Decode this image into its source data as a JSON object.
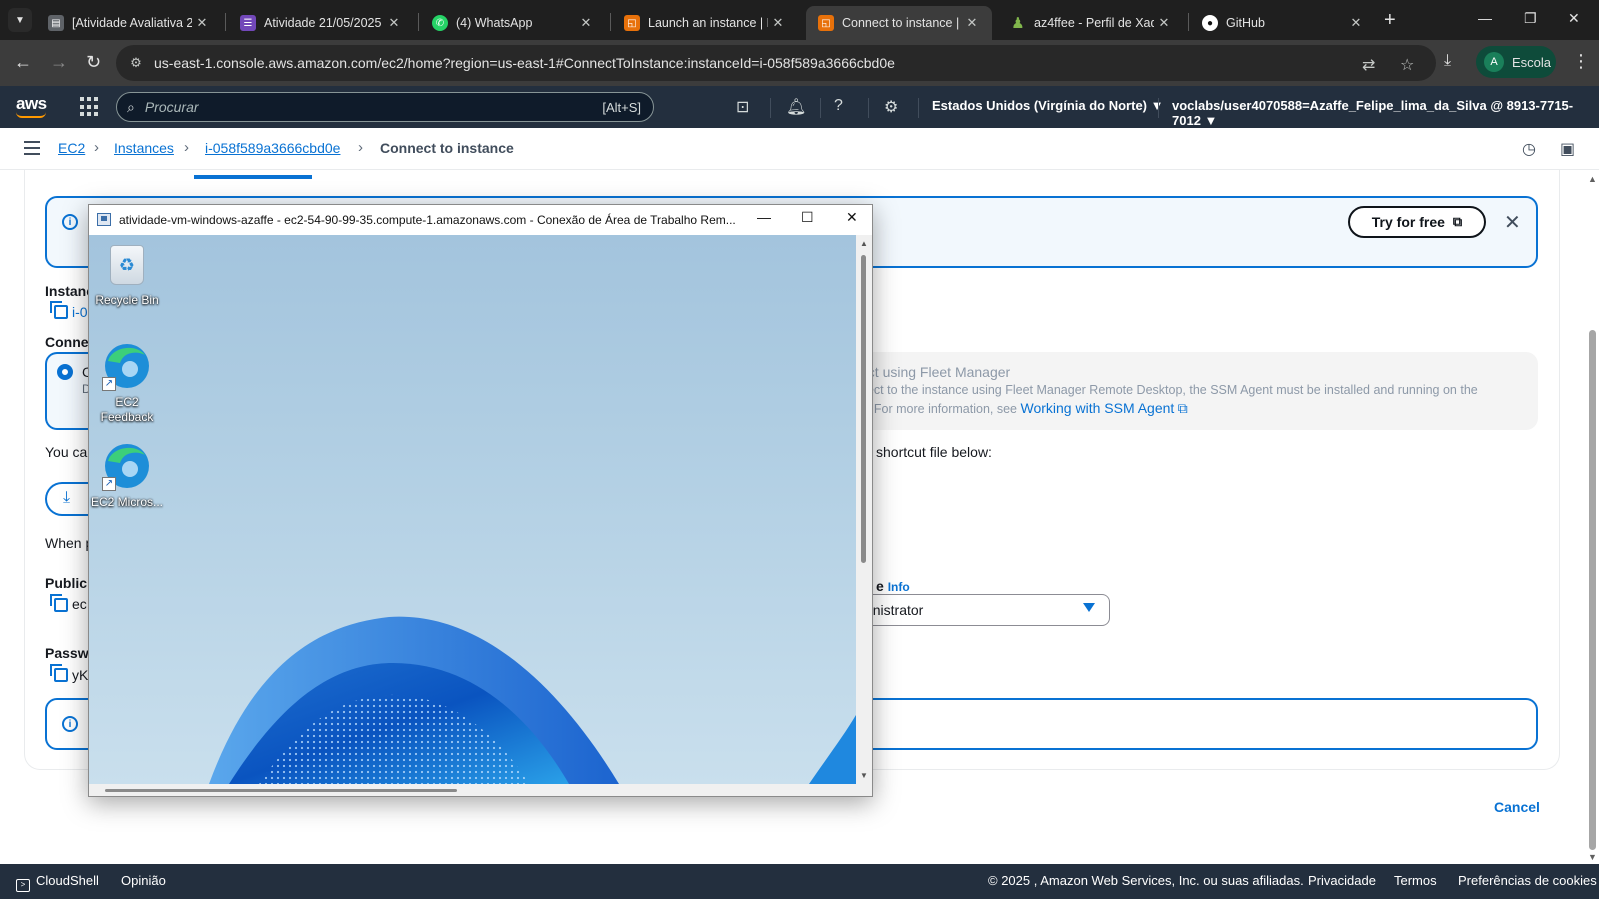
{
  "browser": {
    "tabs": [
      {
        "label": "[Atividade Avaliativa 2]",
        "favicon": "doc-icon",
        "color": "#5f6368"
      },
      {
        "label": "Atividade 21/05/2025",
        "favicon": "form-icon",
        "color": "#7248b9"
      },
      {
        "label": "(4) WhatsApp",
        "favicon": "whatsapp-icon",
        "color": "#25d366"
      },
      {
        "label": "Launch an instance | E",
        "favicon": "aws-icon",
        "color": "#e8710a"
      },
      {
        "label": "Connect to instance | E",
        "favicon": "aws-icon",
        "color": "#e8710a"
      },
      {
        "label": "az4ffee - Perfil de Xadr",
        "favicon": "chess-pawn-icon",
        "color": "#81b64c"
      },
      {
        "label": "GitHub",
        "favicon": "github-icon",
        "color": "#ffffff"
      }
    ],
    "url": "us-east-1.console.aws.amazon.com/ec2/home?region=us-east-1#ConnectToInstance:instanceId=i-058f589a3666cbd0e",
    "profile_initial": "A",
    "profile_label": "Escola"
  },
  "aws_nav": {
    "logo": "aws",
    "search_placeholder": "Procurar",
    "search_shortcut": "[Alt+S]",
    "region": "Estados Unidos (Virgínia do Norte) ▼",
    "account": "voclabs/user4070588=Azaffe_Felipe_lima_da_Silva @ 8913-7715-7012 ▼"
  },
  "breadcrumb": {
    "items": [
      "EC2",
      "Instances",
      "i-058f589a3666cbd0e"
    ],
    "current": "Connect to instance"
  },
  "page": {
    "try_free": "Try for free",
    "instance_label": "Instanc",
    "instance_value": "i-0",
    "connection_label": "Connec",
    "you_can": "You ca",
    "when": "When p",
    "public_label": "Public",
    "public_value": "ec",
    "password_label": "Passwo",
    "password_value": "yK",
    "radio_letter": "C",
    "radio_sub": "D",
    "fleet_title": "ect using Fleet Manager",
    "fleet_line1": "nect to the instance using Fleet Manager Remote Desktop, the SSM Agent must be installed and running on the",
    "fleet_line2": "e. For more information, see",
    "fleet_link": "Working with SSM Agent",
    "shortcut_text": "shortcut file below:",
    "username_label": "e",
    "info_link": "Info",
    "username_value": "ministrator",
    "cancel": "Cancel"
  },
  "rdp_window": {
    "title": "atividade-vm-windows-azaffe - ec2-54-90-99-35.compute-1.amazonaws.com - Conexão de Área de Trabalho Rem...",
    "icons": [
      {
        "label": "Recycle Bin"
      },
      {
        "label": "EC2 Feedback"
      },
      {
        "label": "EC2 Micros..."
      }
    ]
  },
  "footer": {
    "cloudshell": "CloudShell",
    "feedback": "Opinião",
    "copyright": "© 2025 , Amazon Web Services, Inc. ou suas afiliadas.",
    "privacy": "Privacidade",
    "terms": "Termos",
    "cookies": "Preferências de cookies"
  }
}
